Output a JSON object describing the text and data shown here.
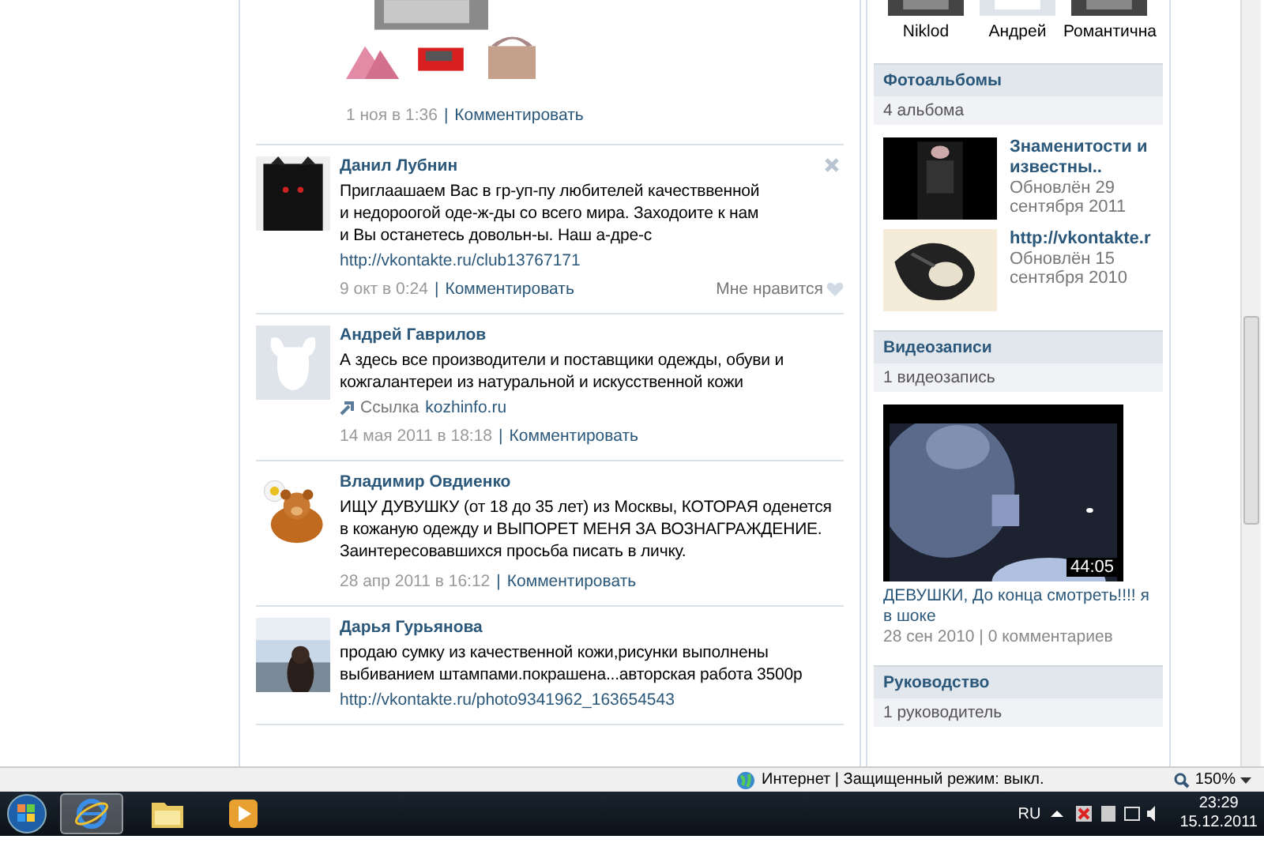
{
  "feed": {
    "posts": [
      {
        "kind": "picture",
        "date": "1 ноя в 1:36",
        "separator": "|",
        "comment_link": "Комментировать"
      },
      {
        "kind": "text",
        "author": "Данил Лубнин",
        "text": "Приглаашаем Вас в гр-уп-пу любителей качестввенной\nи недороогой оде-ж-ды со всего мира. Заходоите к нам\nи Вы останетесь довольн-ы. Наш а-дре-с",
        "link": "http://vkontakte.ru/club13767171",
        "date": "9 окт в 0:24",
        "separator": "|",
        "comment_link": "Комментировать",
        "like": "Мне нравится",
        "deletable": true
      },
      {
        "kind": "text",
        "author": "Андрей Гаврилов",
        "default_avatar": true,
        "text": "А здесь все производители и поставщики одежды, обуви и\nкожгалантереи из натуральной и искусственной кожи",
        "share": {
          "label": "Ссылка",
          "domain": "kozhinfo.ru"
        },
        "date": "14 мая 2011 в 18:18",
        "separator": "|",
        "comment_link": "Комментировать"
      },
      {
        "kind": "text",
        "author": "Владимир Овдиенко",
        "text": "ИЩУ ДУВУШКУ (от 18 до 35 лет) из Москвы, КОТОРАЯ оденется\nв кожаную одежду и ВЫПОРЕТ МЕНЯ ЗА ВОЗНАГРАЖДЕНИЕ.\nЗаинтересовавшихся просьба писать в личку.",
        "date": "28 апр 2011 в 16:12",
        "separator": "|",
        "comment_link": "Комментировать"
      },
      {
        "kind": "text",
        "author": "Дарья Гурьянова",
        "text": "продаю сумку из качественной кожи,рисунки выполнены\nвыбиванием штампами.покрашена...авторская работа 3500р",
        "link": "http://vkontakte.ru/photo9341962_163654543"
      }
    ]
  },
  "sidebar": {
    "friends": [
      {
        "name": "Niklod"
      },
      {
        "name": "Андрей"
      },
      {
        "name": "Романтична"
      }
    ],
    "sections": [
      {
        "kind": "albums",
        "title": "Фотоальбомы",
        "count": "4 альбома",
        "items": [
          {
            "title": "Знаменитости и известны..",
            "updated": "Обновлён 29 сентября 2011"
          },
          {
            "title": "http://vkontakte.r",
            "updated": "Обновлён 15 сентября 2010"
          }
        ]
      },
      {
        "kind": "videos",
        "title": "Видеозаписи",
        "count": "1 видеозапись",
        "items": [
          {
            "duration": "44:05",
            "title": "ДЕВУШКИ, До конца смотреть!!!! я в шоке",
            "meta": "28 сен 2010 | 0 комментариев"
          }
        ]
      },
      {
        "kind": "people",
        "title": "Руководство",
        "count": "1 руководитель"
      }
    ]
  },
  "status_bar": {
    "zone": "Интернет | Защищенный режим: выкл.",
    "zoom": "150%"
  },
  "taskbar": {
    "apps": [
      {
        "kind": "browser",
        "selected": true
      },
      {
        "kind": "folder",
        "selected": false
      },
      {
        "kind": "media",
        "selected": false
      }
    ],
    "language": "RU",
    "time": "23:29",
    "date": "15.12.2011"
  }
}
